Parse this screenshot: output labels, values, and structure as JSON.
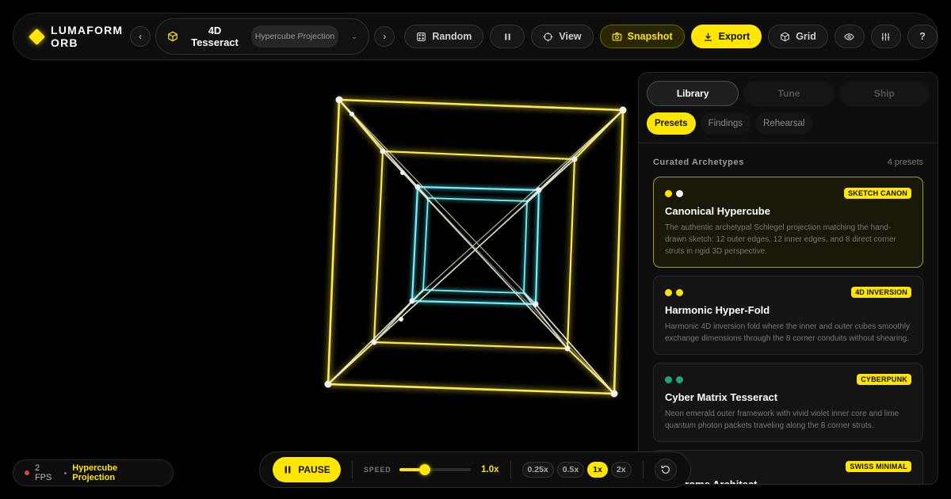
{
  "brand": {
    "name": "LUMAFORM ORB"
  },
  "preset_selector": {
    "title": "4D Tesseract",
    "subtitle": "Hypercube Projection",
    "prev_label": "‹",
    "next_label": "›"
  },
  "toolbar": {
    "random_label": "Random",
    "view_label": "View",
    "snapshot_label": "Snapshot",
    "export_label": "Export",
    "grid_label": "Grid",
    "help_label": "?"
  },
  "panel": {
    "tabs": [
      {
        "label": "Library"
      },
      {
        "label": "Tune"
      },
      {
        "label": "Ship"
      }
    ],
    "subtabs": [
      {
        "label": "Presets"
      },
      {
        "label": "Findings"
      },
      {
        "label": "Rehearsal"
      }
    ],
    "section_title": "Curated Archetypes",
    "section_count": "4 presets",
    "cards": [
      {
        "tag": "SKETCH CANON",
        "title": "Canonical Hypercube",
        "description": "The authentic archetypal Schlegel projection matching the hand-drawn sketch: 12 outer edges, 12 inner edges, and 8 direct corner struts in rigid 3D perspective.",
        "dot_colors": [
          "#ffe600",
          "#f2f2f2"
        ]
      },
      {
        "tag": "4D INVERSION",
        "title": "Harmonic Hyper-Fold",
        "description": "Harmonic 4D inversion fold where the inner and outer cubes smoothly exchange dimensions through the 8 corner conduits without shearing.",
        "dot_colors": [
          "#ffe600",
          "#ffe600"
        ]
      },
      {
        "tag": "CYBERPUNK",
        "title": "Cyber Matrix Tesseract",
        "description": "Neon emerald outer framework with vivid violet inner core and lime quantum photon packets traveling along the 8 corner struts.",
        "dot_colors": [
          "#1fa37a",
          "#1fa37a"
        ]
      },
      {
        "tag": "SWISS MINIMAL",
        "title": "chrome Architect",
        "description": "",
        "dot_colors": []
      }
    ]
  },
  "status": {
    "fps": "2 FPS",
    "mode": "Hypercube Projection"
  },
  "playback": {
    "pause_label": "PAUSE",
    "speed_label": "SPEED",
    "speed_value": "1.0x",
    "speed_fraction": 0.36,
    "speed_options": [
      "0.25x",
      "0.5x",
      "1x",
      "2x"
    ],
    "active_speed": "1x"
  },
  "colors": {
    "accent": "#ffe600",
    "outer_frame": "#ffe94a",
    "inner_core": "#6ff3ff",
    "struts": "#f4f4d8"
  }
}
